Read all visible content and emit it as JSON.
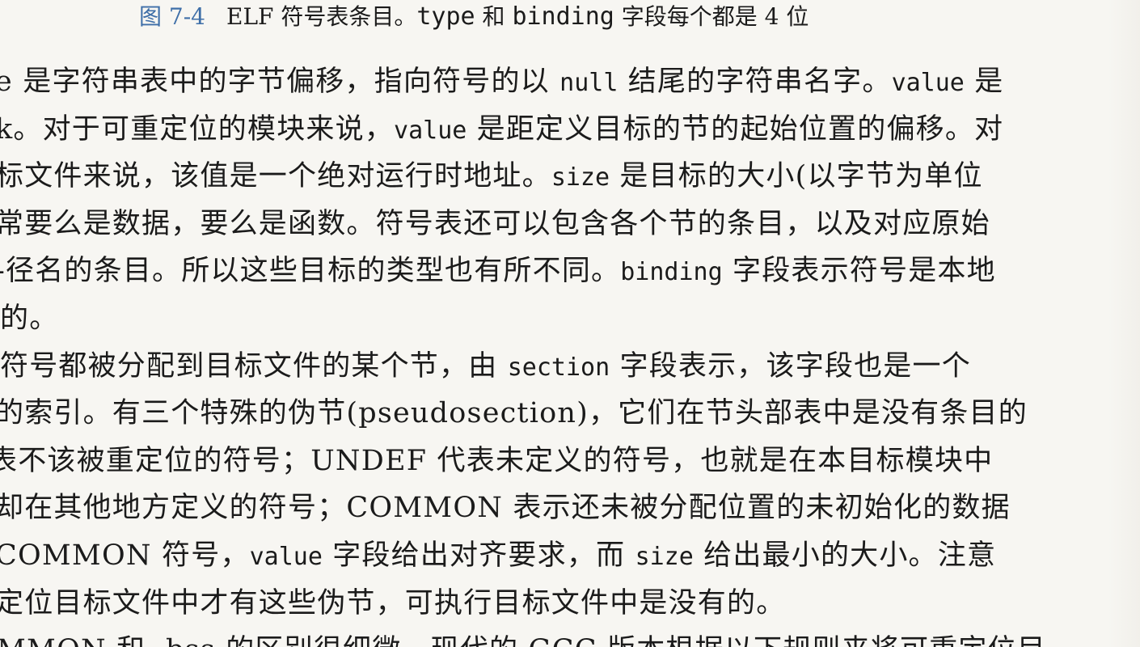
{
  "caption": {
    "label": "图 7-4",
    "text_prefix": "ELF 符号表条目。",
    "text_type": "type",
    "text_mid": " 和 ",
    "text_binding": "binding",
    "text_suffix": " 字段每个都是 4 位"
  },
  "lines": [
    {
      "segments": [
        {
          "t": "e 是字符串表中的字节偏移，指向符号的以 ",
          "mono": false
        },
        {
          "t": "null",
          "mono": true
        },
        {
          "t": " 结尾的字符串名字。",
          "mono": false
        },
        {
          "t": "value",
          "mono": true
        },
        {
          "t": " 是",
          "mono": false
        }
      ],
      "indent": -6
    },
    {
      "segments": [
        {
          "t": "k。对于可重定位的模块来说，",
          "mono": false
        },
        {
          "t": "value",
          "mono": true
        },
        {
          "t": " 是距定义目标的节的起始位置的偏移。对",
          "mono": false
        }
      ],
      "indent": -6
    },
    {
      "segments": [
        {
          "t": " 标文件来说，该值是一个绝对运行时地址。",
          "mono": false
        },
        {
          "t": "size",
          "mono": true
        },
        {
          "t": " 是目标的大小(以字节为单位",
          "mono": false
        }
      ],
      "indent": -6
    },
    {
      "segments": [
        {
          "t": "常要么是数据，要么是函数。符号表还可以包含各个节的条目，以及对应原始",
          "mono": false
        }
      ],
      "indent": -6
    },
    {
      "segments": [
        {
          "t": "-径名的条目。所以这些目标的类型也有所不同。",
          "mono": false
        },
        {
          "t": "binding",
          "mono": true
        },
        {
          "t": " 字段表示符号是本地",
          "mono": false
        }
      ],
      "indent": -6
    },
    {
      "segments": [
        {
          "t": "的。",
          "mono": false
        }
      ],
      "indent": 0
    },
    {
      "segments": [
        {
          "t": "符号都被分配到目标文件的某个节，由 ",
          "mono": false
        },
        {
          "t": "section",
          "mono": true
        },
        {
          "t": " 字段表示，该字段也是一个",
          "mono": false
        }
      ],
      "indent": 0
    },
    {
      "segments": [
        {
          "t": "的索引。有三个特殊的伪节(pseudosection)，它们在节头部表中是没有条目的",
          "mono": false
        }
      ],
      "indent": -6
    },
    {
      "segments": [
        {
          "t": "表不该被重定位的符号；UNDEF 代表未定义的符号，也就是在本目标模块中",
          "mono": false
        }
      ],
      "indent": -14
    },
    {
      "segments": [
        {
          "t": " 却在其他地方定义的符号；COMMON 表示还未被分配位置的未初始化的数据",
          "mono": false
        }
      ],
      "indent": -6
    },
    {
      "segments": [
        {
          "t": " COMMON 符号，",
          "mono": false
        },
        {
          "t": "value",
          "mono": true
        },
        {
          "t": " 字段给出对齐要求，而 ",
          "mono": false
        },
        {
          "t": "size",
          "mono": true
        },
        {
          "t": " 给出最小的大小。注意",
          "mono": false
        }
      ],
      "indent": -6
    },
    {
      "segments": [
        {
          "t": " 定位目标文件中才有这些伪节，可执行目标文件中是没有的。",
          "mono": false
        }
      ],
      "indent": -6
    },
    {
      "segments": [
        {
          "t": "MMON 和 .bss 的区别很细微。现代的 GCC 版本根据以下规则来将可重定位目",
          "mono": false
        }
      ],
      "indent": -4
    }
  ]
}
